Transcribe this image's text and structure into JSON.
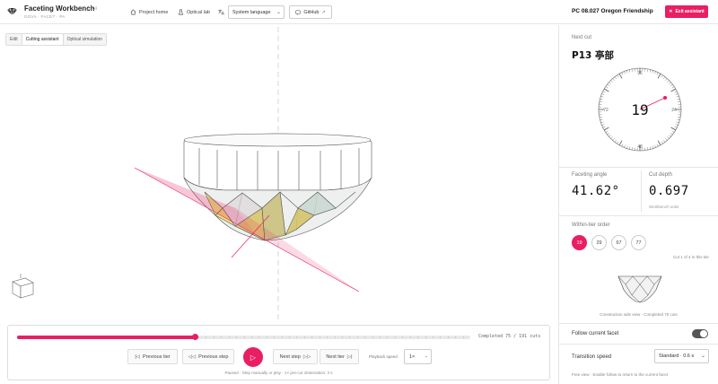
{
  "header": {
    "brand_title": "Faceting Workbench",
    "brand_version": "3.3.4",
    "brand_sub": "GOVA · FACET · PA",
    "nav": [
      {
        "label": "Project home",
        "icon": "home-icon"
      },
      {
        "label": "Optical lab",
        "icon": "flask-icon"
      }
    ],
    "language_value": "System language",
    "github_label": "GitHub",
    "design_title": "PC 08.027 Oregon Friendship",
    "exit_label": "Exit assistant",
    "accent": "#e91e63"
  },
  "mode_tabs": [
    {
      "label": "Edit",
      "active": false
    },
    {
      "label": "Cutting assistant",
      "active": true
    },
    {
      "label": "Optical simulation",
      "active": false
    }
  ],
  "player": {
    "progress_fraction": 0.3927,
    "completed_text": "Completed 75 / 191 cuts",
    "buttons": {
      "previous_tier": "Previous tier",
      "previous_step": "Previous step",
      "next_step": "Next step",
      "next_tier": "Next tier"
    },
    "speed_label": "Playback speed",
    "speed_value": "1×",
    "status": "Paused · Step manually or play · 1× pre-cut observation: 3 s"
  },
  "panel": {
    "next_cut_label": "Next cut",
    "next_cut_code": "P13 亭部",
    "dial": {
      "index_value": "19",
      "ticks": [
        "96",
        "24",
        "48",
        "72"
      ]
    },
    "faceting_angle_label": "Faceting angle",
    "faceting_angle_value": "41.62°",
    "cut_depth_label": "Cut depth",
    "cut_depth_value": "0.697",
    "cut_depth_unit": "Workbench units",
    "order_label": "Within-tier order",
    "order_items": [
      "19",
      "29",
      "67",
      "77"
    ],
    "cut_note": "Cut 1 of 4 in this tier",
    "thumb_caption": "Construction side view · Completed 75 cuts",
    "follow_label": "Follow current facet",
    "transition_label": "Transition speed",
    "transition_value": "Standard · 0.6 s",
    "footnote": "Free view · Enable follow to return to the current facet"
  }
}
